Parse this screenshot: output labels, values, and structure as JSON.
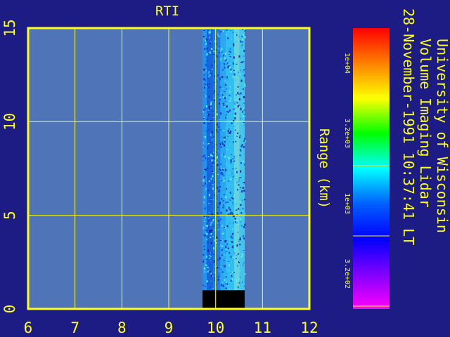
{
  "colors": {
    "background": "#1c1c84",
    "plot_area": "#4f74b8",
    "axis": "#ffff1e",
    "text": "#ffff1e",
    "no_data": "#000000"
  },
  "chart_data": {
    "type": "heatmap",
    "title": "RTI",
    "xlabel": "",
    "ylabel": "Range (km)",
    "xlim": [
      6,
      12
    ],
    "ylim": [
      0,
      15
    ],
    "x_ticks": [
      "6",
      "7",
      "8",
      "9",
      "10",
      "11",
      "12"
    ],
    "y_ticks": [
      "0",
      "5",
      "10",
      "15"
    ],
    "grid": true,
    "data_extent": {
      "x": [
        9.72,
        10.62
      ],
      "y": [
        0,
        15
      ]
    },
    "no_data_region": {
      "x": [
        9.72,
        10.62
      ],
      "y": [
        0,
        1.0
      ]
    },
    "info_lines": [
      "University of Wisconsin",
      "Volume Imaging Lidar",
      "28-November-1991 10:37:41 LT"
    ],
    "colorbar": {
      "tick_labels": [
        "1e+04",
        "3.2e+03",
        "1e+03",
        "3.2e+02"
      ],
      "colors": [
        "#ff0000",
        "#ff8000",
        "#ffff00",
        "#00ff00",
        "#00ffff",
        "#0060ff",
        "#0000ff",
        "#8000ff",
        "#ff00ff"
      ]
    }
  }
}
